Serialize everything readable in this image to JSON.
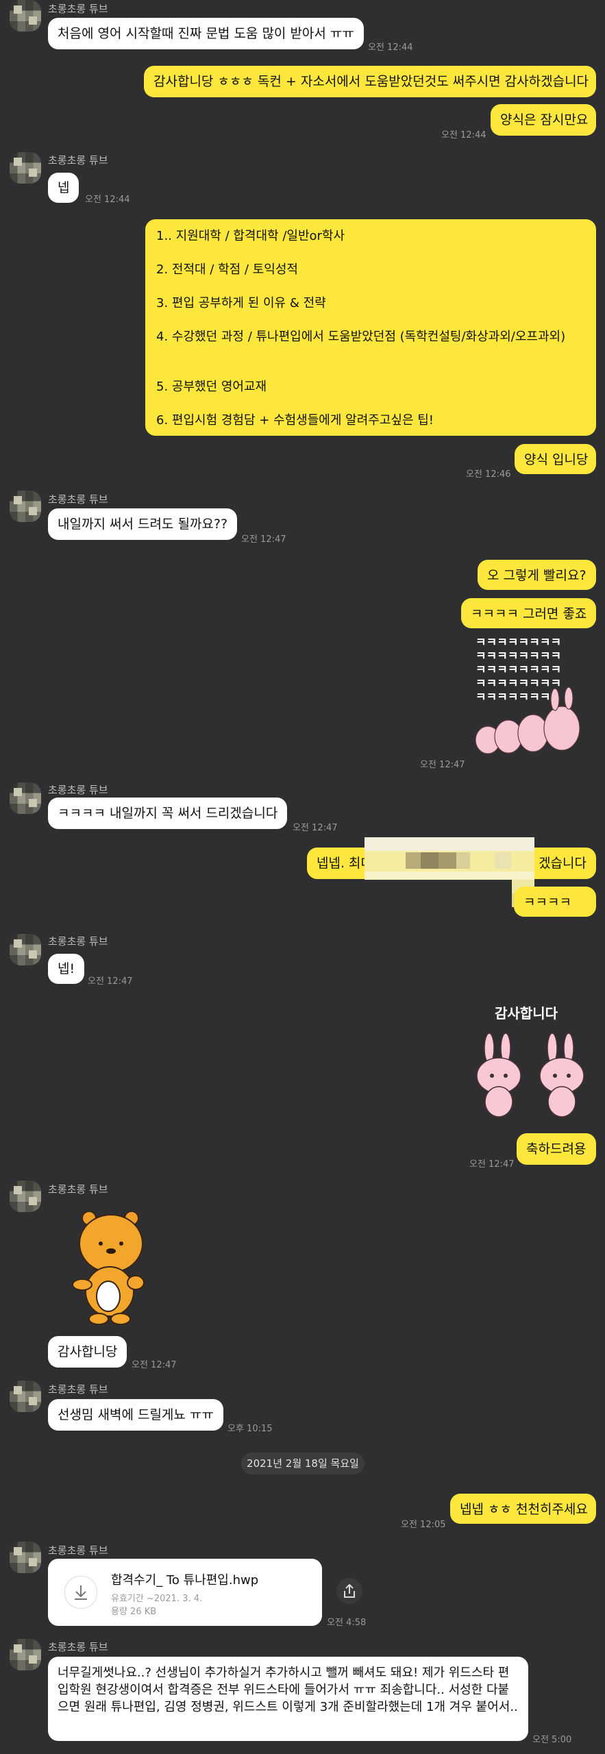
{
  "sender": "초롱초롱 튜브",
  "messages": {
    "m1": "처음에 영어 시작할때 진짜 문법 도움 많이 받아서 ㅠㅠ",
    "t1": "오전 12:44",
    "m2": "감사합니당 ㅎㅎㅎ 독컨 + 자소서에서 도움받았던것도 써주시면 감사하겠습니다",
    "m3": "양식은 잠시만요",
    "t3": "오전 12:44",
    "m4": "넵",
    "t4": "오전 12:44",
    "list": [
      "1.. 지원대학 / 합격대학 /일반or학사",
      "2. 전적대 / 학점 / 토익성적",
      "3. 편입 공부하게 된 이유 & 전략",
      "4. 수강했던 과정 / 튜나편입에서 도움받았던점 (독학컨설팅/화상과외/오프과외)",
      "5. 공부했던 영어교재",
      "6. 편입시험 경험담 + 수험생들에게 알려주고싶은 팁!"
    ],
    "m6": "양식 입니당",
    "t6": "오전 12:46",
    "m7": "내일까지 써서 드려도 될까요??",
    "t7": "오전 12:47",
    "m8": "오 그렇게 빨리요?",
    "m9": "ㅋㅋㅋㅋ 그러면 좋죠",
    "t9": "오전 12:47",
    "m10": "ㅋㅋㅋㅋ 내일까지 꼭 써서 드리겠습니다",
    "t10": "오전 12:47",
    "m11_start": "넵넵. 최대한",
    "m11_end": "겠습니다",
    "m12": "ㅋㅋㅋㅋ",
    "m13": "넵!",
    "t13": "오전 12:47",
    "sticker_text": "감사합니다",
    "m14": "축하드려용",
    "t14": "오전 12:47",
    "m15": "감사합니당",
    "t15": "오전 12:47",
    "m16": "선생밈 새벽에 드릴게뇨 ㅠㅠ",
    "t16": "오후 10:15",
    "date": "2021년 2월 18일 목요일",
    "m17": "넵넵 ㅎㅎ 천천히주세요",
    "t17": "오전 12:05",
    "file_name": "합격수기_ To 튜나편입.hwp",
    "file_validity": "유효기간 ~2021. 3. 4.",
    "file_size": "용량 26 KB",
    "t18": "오전 4:58",
    "m19": "너무길게썻나요..? 선생님이 추가하실거 추가하시고 뺄꺼 빼셔도 돼요! 제가 위드스타 편입학원 현강생이여서 합격증은 전부 위드스타에 들어가서 ㅠㅠ 죄송합니다.. 서성한 다붙으면 원래 튜나편입, 김영 정병권, 위드스트 이렇게 3개 준비할라했는데 1개 겨우 붙어서..",
    "t19": "오전 5:00"
  }
}
